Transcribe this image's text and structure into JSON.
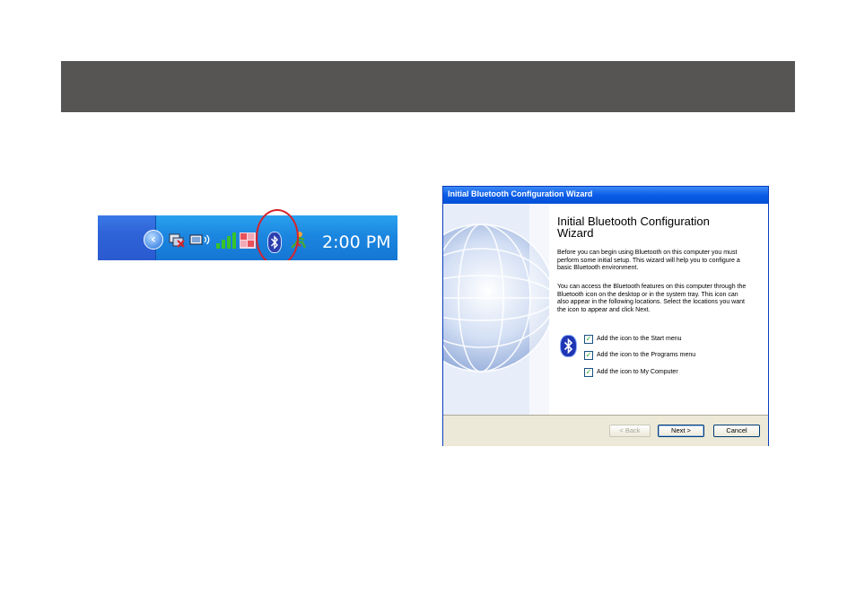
{
  "taskbar": {
    "clock": "2:00 PM"
  },
  "wizard": {
    "title": "Initial Bluetooth Configuration Wizard",
    "heading_line1": "Initial Bluetooth Configuration",
    "heading_line2": "Wizard",
    "paragraph1": "Before you can begin using Bluetooth on this computer you must perform some initial setup. This wizard will help you to configure a basic Bluetooth environment.",
    "paragraph2": "You can access the Bluetooth features on this computer through the Bluetooth icon on the desktop or in the system tray. This icon can also appear in the following locations. Select the locations you want the icon to appear and click Next.",
    "options": [
      {
        "label": "Add the icon to the Start menu",
        "checked": true
      },
      {
        "label": "Add the icon to the Programs menu",
        "checked": true
      },
      {
        "label": "Add the icon to My Computer",
        "checked": true
      }
    ],
    "buttons": {
      "back": "< Back",
      "next": "Next >",
      "cancel": "Cancel"
    }
  },
  "colors": {
    "header_bar": "#575553",
    "highlight_ring": "#d6222a",
    "xp_title_blue": "#0a5ce8"
  }
}
